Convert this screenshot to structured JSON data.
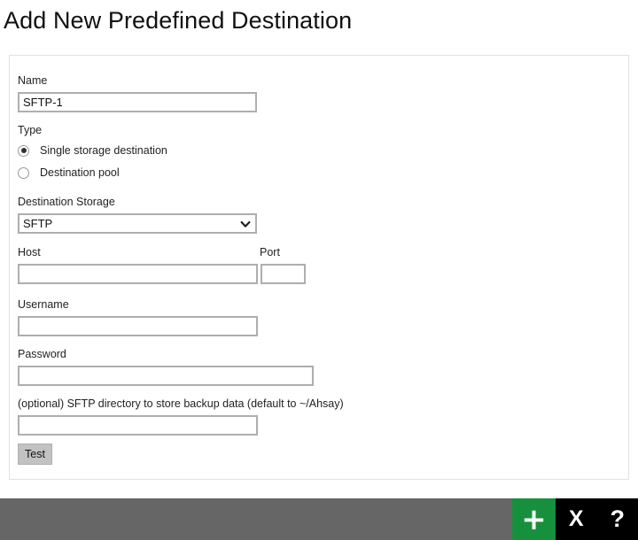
{
  "page": {
    "title": "Add New Predefined Destination"
  },
  "form": {
    "name": {
      "label": "Name",
      "value": "SFTP-1",
      "placeholder": ""
    },
    "type": {
      "label": "Type",
      "options": [
        {
          "label": "Single storage destination",
          "selected": true
        },
        {
          "label": "Destination pool",
          "selected": false
        }
      ]
    },
    "destination_storage": {
      "label": "Destination Storage",
      "value": "SFTP",
      "arrow_icon": "chevron-down-icon"
    },
    "host": {
      "label": "Host",
      "value": "",
      "placeholder": ""
    },
    "port": {
      "label": "Port",
      "value": "",
      "placeholder": ""
    },
    "username": {
      "label": "Username",
      "value": "",
      "placeholder": ""
    },
    "password": {
      "label": "Password",
      "value": "",
      "placeholder": ""
    },
    "directory": {
      "label": "(optional) SFTP directory to store backup data (default to ~/Ahsay)",
      "value": "",
      "placeholder": ""
    },
    "test_button": {
      "label": "Test"
    }
  },
  "toolbar": {
    "add": {
      "icon": "plus-icon",
      "glyph": "+"
    },
    "close": {
      "icon": "close-x-icon",
      "glyph": "X"
    },
    "help": {
      "icon": "question-mark-icon",
      "glyph": "?"
    }
  },
  "colors": {
    "add_green": "#17903d",
    "bar_gray": "#666666",
    "bar_black": "#000000",
    "input_border": "#aeaeae",
    "button_gray": "#c2c2c2"
  }
}
